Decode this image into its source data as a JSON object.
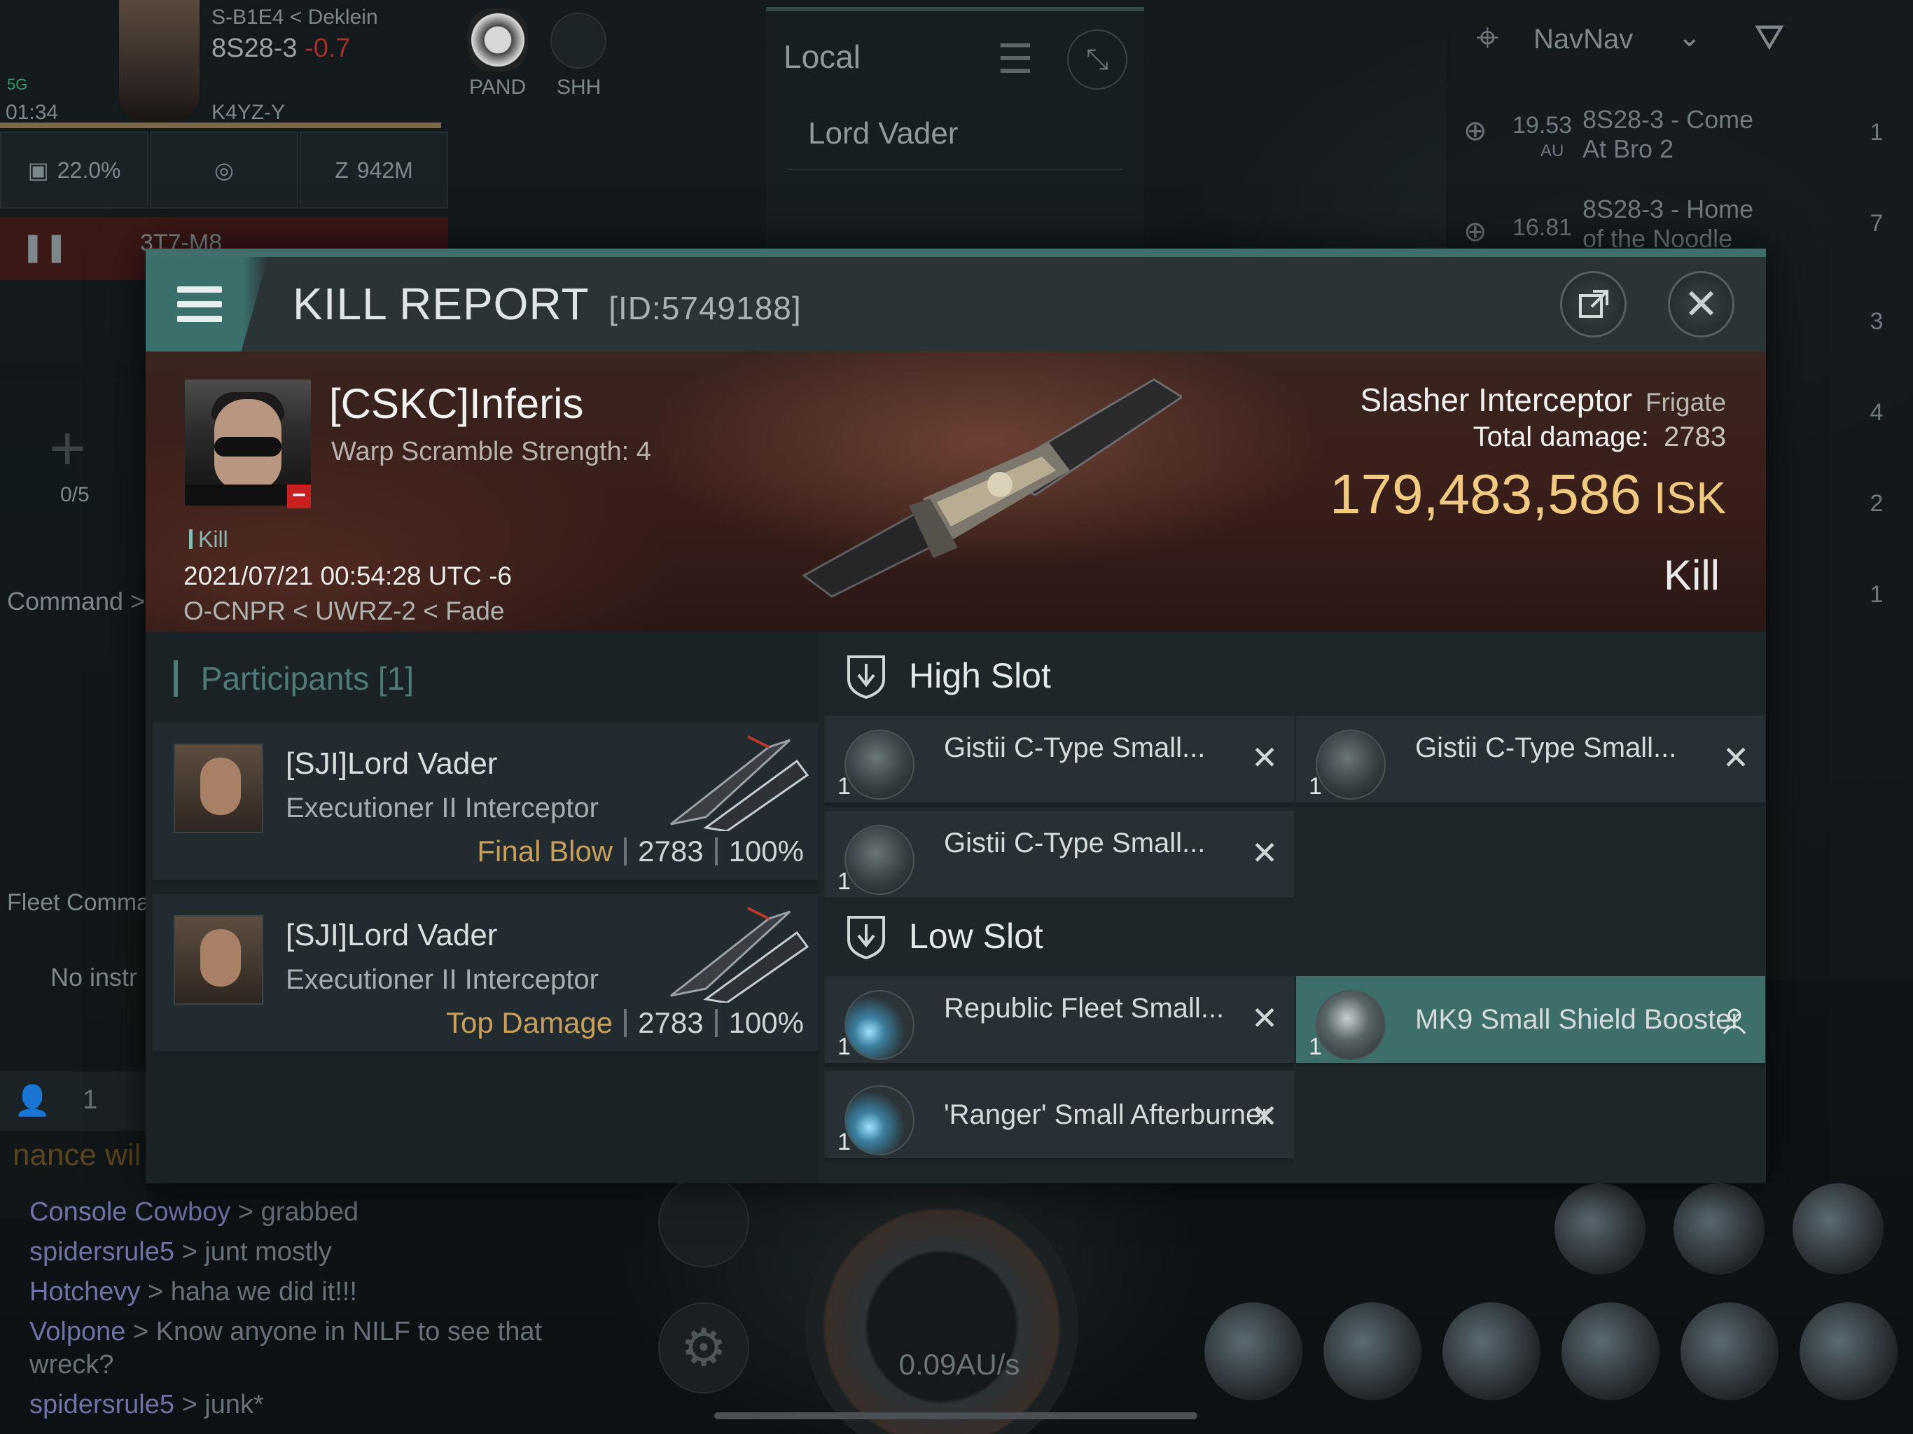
{
  "hud": {
    "system_path": "S-B1E4 < Deklein",
    "current_system": "8S28-3",
    "security": "-0.7",
    "signal": "5G",
    "time": "01:34",
    "pilot_sub": "K4YZ-Y",
    "corp_tags": [
      "PAND",
      "SHH"
    ],
    "stats": {
      "cargo": "22.0%",
      "isk": "942M"
    },
    "route_dest": "3T7-M8",
    "fleet_count": "0/5",
    "command_label": "Command >",
    "fleet_command_label": "Fleet Comma",
    "no_instructions": "No instr",
    "member_count": "1",
    "speed": "0.09AU/s"
  },
  "local": {
    "title": "Local",
    "members": [
      "Lord Vader"
    ]
  },
  "navnav": {
    "title": "NavNav",
    "entries": [
      {
        "distance": "19.53",
        "unit": "AU",
        "name_line1": "8S28-3 - Come",
        "name_line2": "At Bro 2"
      },
      {
        "distance": "16.81",
        "unit": "",
        "name_line1": "8S28-3 - Home",
        "name_line2": "of the Noodle"
      }
    ],
    "side_counts": [
      "1",
      "7",
      "3",
      "4",
      "2",
      "1"
    ]
  },
  "chat": [
    {
      "name": "",
      "text": "nance wil"
    },
    {
      "name": "Console Cowboy",
      "text": "> grabbed"
    },
    {
      "name": "spidersrule5",
      "text": "> junt mostly"
    },
    {
      "name": "Hotchevy",
      "text": "> haha we did it!!!"
    },
    {
      "name": "Volpone",
      "text": "> Know anyone in NILF to see that"
    },
    {
      "name": "",
      "text": "wreck?"
    },
    {
      "name": "spidersrule5",
      "text": "> junk*"
    }
  ],
  "kill_report": {
    "title": "KILL REPORT",
    "id_label": "[ID:5749188]",
    "victim": {
      "name": "[CSKC]Inferis",
      "warp_scramble": "Warp Scramble Strength: 4",
      "tag": "Kill",
      "datetime": "2021/07/21 00:54:28 UTC -6",
      "location": "O-CNPR < UWRZ-2 < Fade"
    },
    "ship": {
      "name": "Slasher Interceptor",
      "class": "Frigate",
      "total_damage_label": "Total damage:",
      "total_damage": "2783",
      "isk_value": "179,483,586",
      "isk_unit": "ISK",
      "result": "Kill"
    },
    "participants_label": "Participants",
    "participants_count": "[1]",
    "participants": [
      {
        "name": "[SJI]Lord Vader",
        "ship": "Executioner II Interceptor",
        "role": "Final Blow",
        "damage": "2783",
        "percent": "100%"
      },
      {
        "name": "[SJI]Lord Vader",
        "ship": "Executioner II Interceptor",
        "role": "Top Damage",
        "damage": "2783",
        "percent": "100%"
      }
    ],
    "high_slot_label": "High Slot",
    "high_slot": [
      {
        "qty": "1",
        "name": "Gistii C-Type Small..."
      },
      {
        "qty": "1",
        "name": "Gistii C-Type Small..."
      },
      {
        "qty": "1",
        "name": "Gistii C-Type Small..."
      }
    ],
    "low_slot_label": "Low Slot",
    "low_slot": [
      {
        "qty": "1",
        "name": "Republic Fleet Small..."
      },
      {
        "qty": "1",
        "name": "MK9 Small Shield Booster"
      },
      {
        "qty": "1",
        "name": "'Ranger' Small Afterburner"
      }
    ]
  }
}
